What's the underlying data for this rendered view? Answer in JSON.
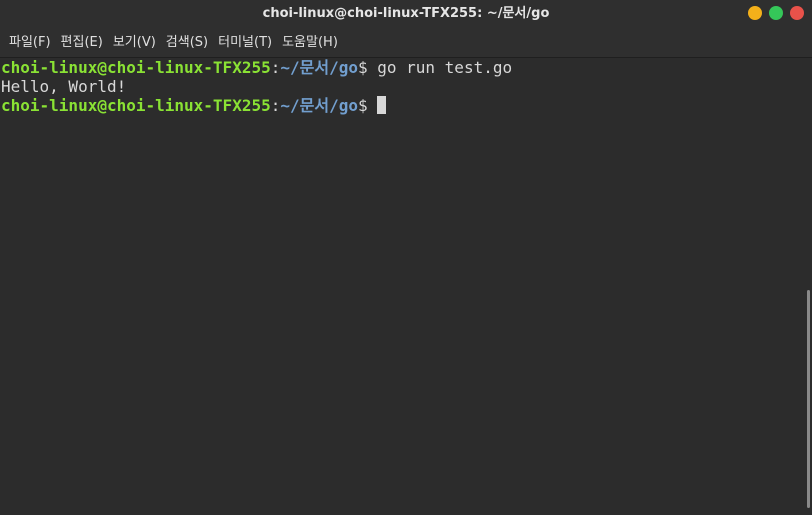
{
  "window": {
    "title": "choi-linux@choi-linux-TFX255: ~/문서/go",
    "buttons": [
      {
        "name": "minimize",
        "color": "#f4b01a"
      },
      {
        "name": "maximize",
        "color": "#35c759"
      },
      {
        "name": "close",
        "color": "#e9524a"
      }
    ]
  },
  "menu": {
    "items": [
      {
        "label": "파일(F)"
      },
      {
        "label": "편집(E)"
      },
      {
        "label": "보기(V)"
      },
      {
        "label": "검색(S)"
      },
      {
        "label": "터미널(T)"
      },
      {
        "label": "도움말(H)"
      }
    ]
  },
  "terminal": {
    "colors": {
      "user": "#8ae234",
      "path": "#729fcf",
      "text": "#d8d8d8",
      "background": "#2c2c2c"
    },
    "lines": [
      {
        "user": "choi-linux@choi-linux-TFX255",
        "sep": ":",
        "path": "~/문서/go",
        "prompt": "$",
        "command": " go run test.go"
      },
      {
        "output": "Hello, World!"
      },
      {
        "user": "choi-linux@choi-linux-TFX255",
        "sep": ":",
        "path": "~/문서/go",
        "prompt": "$",
        "command": " "
      }
    ]
  }
}
